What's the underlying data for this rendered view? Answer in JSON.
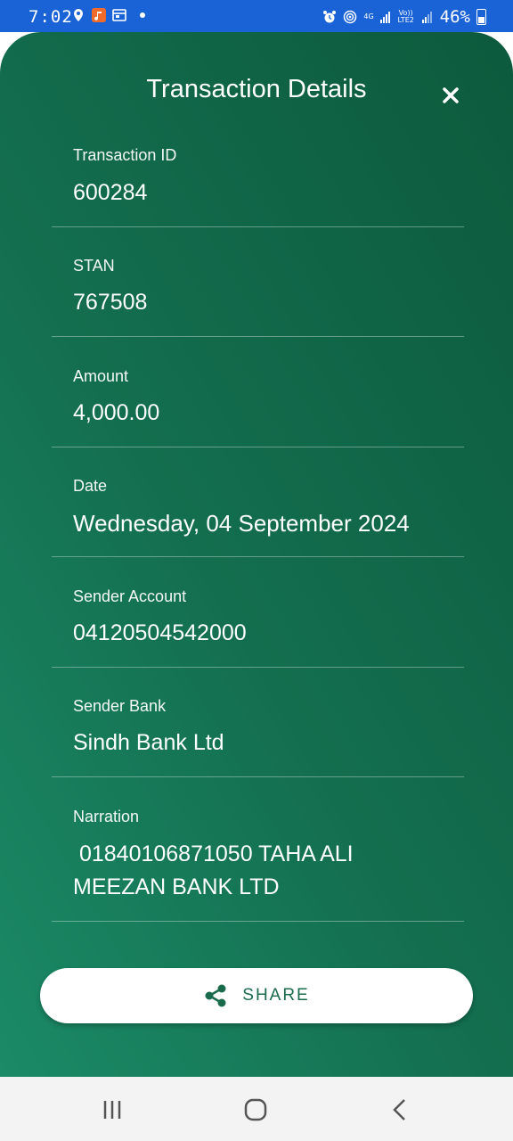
{
  "status_bar": {
    "time": "7:02",
    "network": "4G",
    "volte": "Vo)) LTE2",
    "battery": "46%"
  },
  "sheet": {
    "title": "Transaction Details",
    "close_icon": "close-icon"
  },
  "fields": [
    {
      "label": "Transaction ID",
      "value": "600284"
    },
    {
      "label": "STAN",
      "value": "767508"
    },
    {
      "label": "Amount",
      "value": "4,000.00"
    },
    {
      "label": "Date",
      "value": "Wednesday, 04 September 2024"
    },
    {
      "label": "Sender Account",
      "value": "04120504542000"
    },
    {
      "label": "Sender Bank",
      "value": "Sindh Bank Ltd"
    },
    {
      "label": "Narration",
      "value": " 01840106871050 TAHA ALI MEEZAN BANK LTD"
    }
  ],
  "share_button": {
    "label": "SHARE",
    "icon": "share-icon"
  },
  "colors": {
    "status_bar": "#1a63d6",
    "sheet_light": "#1b8a66",
    "sheet_dark": "#0d5a3d",
    "accent": "#1a6b4c"
  },
  "nav": {
    "recents_icon": "recents-icon",
    "home_icon": "home-icon",
    "back_icon": "back-icon"
  }
}
